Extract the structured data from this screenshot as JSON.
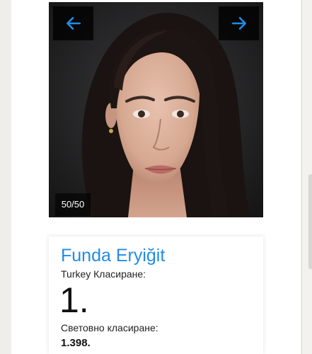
{
  "gallery": {
    "counter": "50/50",
    "prev_icon": "arrow-left-icon",
    "next_icon": "arrow-right-icon",
    "accent_color": "#1f8ce6"
  },
  "profile": {
    "name": "Funda Eryiğit",
    "country_rank_label": "Turkey Класиране:",
    "country_rank": "1.",
    "world_rank_label": "Световно класиране:",
    "world_rank": "1.398."
  }
}
